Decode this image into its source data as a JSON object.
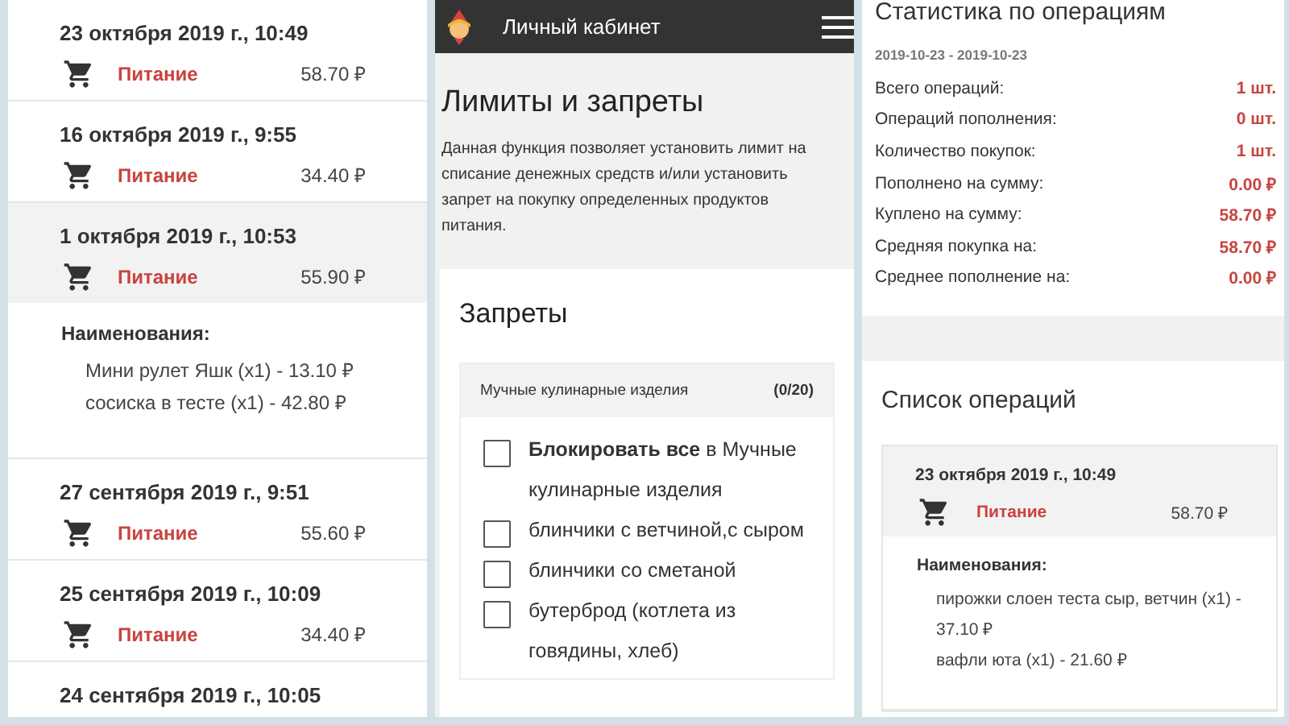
{
  "history_panel": {
    "operations": [
      {
        "date": "23 октября 2019 г., 10:49",
        "category": "Питание",
        "amount": "58.70 ₽",
        "expanded": false
      },
      {
        "date": "16 октября 2019 г., 9:55",
        "category": "Питание",
        "amount": "34.40 ₽",
        "expanded": false
      },
      {
        "date": "1 октября 2019 г., 10:53",
        "category": "Питание",
        "amount": "55.90 ₽",
        "expanded": true,
        "items_title": "Наименования:",
        "items": [
          "Мини рулет Яшк (x1) - 13.10 ₽",
          "сосиска в тесте (x1) - 42.80 ₽"
        ]
      },
      {
        "date": "27 сентября 2019 г., 9:51",
        "category": "Питание",
        "amount": "55.60 ₽",
        "expanded": false
      },
      {
        "date": "25 сентября 2019 г., 10:09",
        "category": "Питание",
        "amount": "34.40 ₽",
        "expanded": false
      },
      {
        "date": "24 сентября 2019 г., 10:05",
        "expanded": false
      }
    ]
  },
  "limits_panel": {
    "app_bar": {
      "title": "Личный кабинет"
    },
    "heading": "Лимиты и запреты",
    "description": "Данная функция позволяет установить лимит на списание денежных средств и/или установить запрет на покупку определенных продуктов питания.",
    "card": {
      "title": "Запреты",
      "group": {
        "name": "Мучные кулинарные изделия",
        "count": "(0/20)",
        "options": [
          {
            "label": "**Блокировать все** в Мучные кулинарные изделия",
            "checked": false
          },
          {
            "label": "блинчики с ветчиной,с сыром",
            "checked": false
          },
          {
            "label": "блинчики со сметаной",
            "checked": false
          },
          {
            "label": "бутерброд (котлета из говядины, хлеб)",
            "checked": false
          }
        ]
      }
    }
  },
  "stats_panel": {
    "title": "Статистика по операциям",
    "period": "2019-10-23 - 2019-10-23",
    "rows": [
      {
        "label": "Всего операций:",
        "value": "1 шт."
      },
      {
        "label": "Операций пополнения:",
        "value": "0 шт."
      },
      {
        "label": "Количество покупок:",
        "value": "1 шт."
      },
      {
        "label": "Пополнено на сумму:",
        "value": "0.00 ₽"
      },
      {
        "label": "Куплено на сумму:",
        "value": "58.70 ₽"
      },
      {
        "label": "Средняя покупка на:",
        "value": "58.70 ₽"
      },
      {
        "label": "Среднее пополнение на:",
        "value": "0.00 ₽"
      }
    ],
    "list": {
      "title": "Список операций",
      "operations": [
        {
          "date": "23 октября 2019 г., 10:49",
          "category": "Питание",
          "amount": "58.70 ₽",
          "expanded": true,
          "items_title": "Наименования:",
          "items": [
            "пирожки слоен теста сыр, ветчин (x1) - 37.10 ₽",
            "вафли юта (x1) - 21.60 ₽"
          ]
        }
      ]
    }
  }
}
